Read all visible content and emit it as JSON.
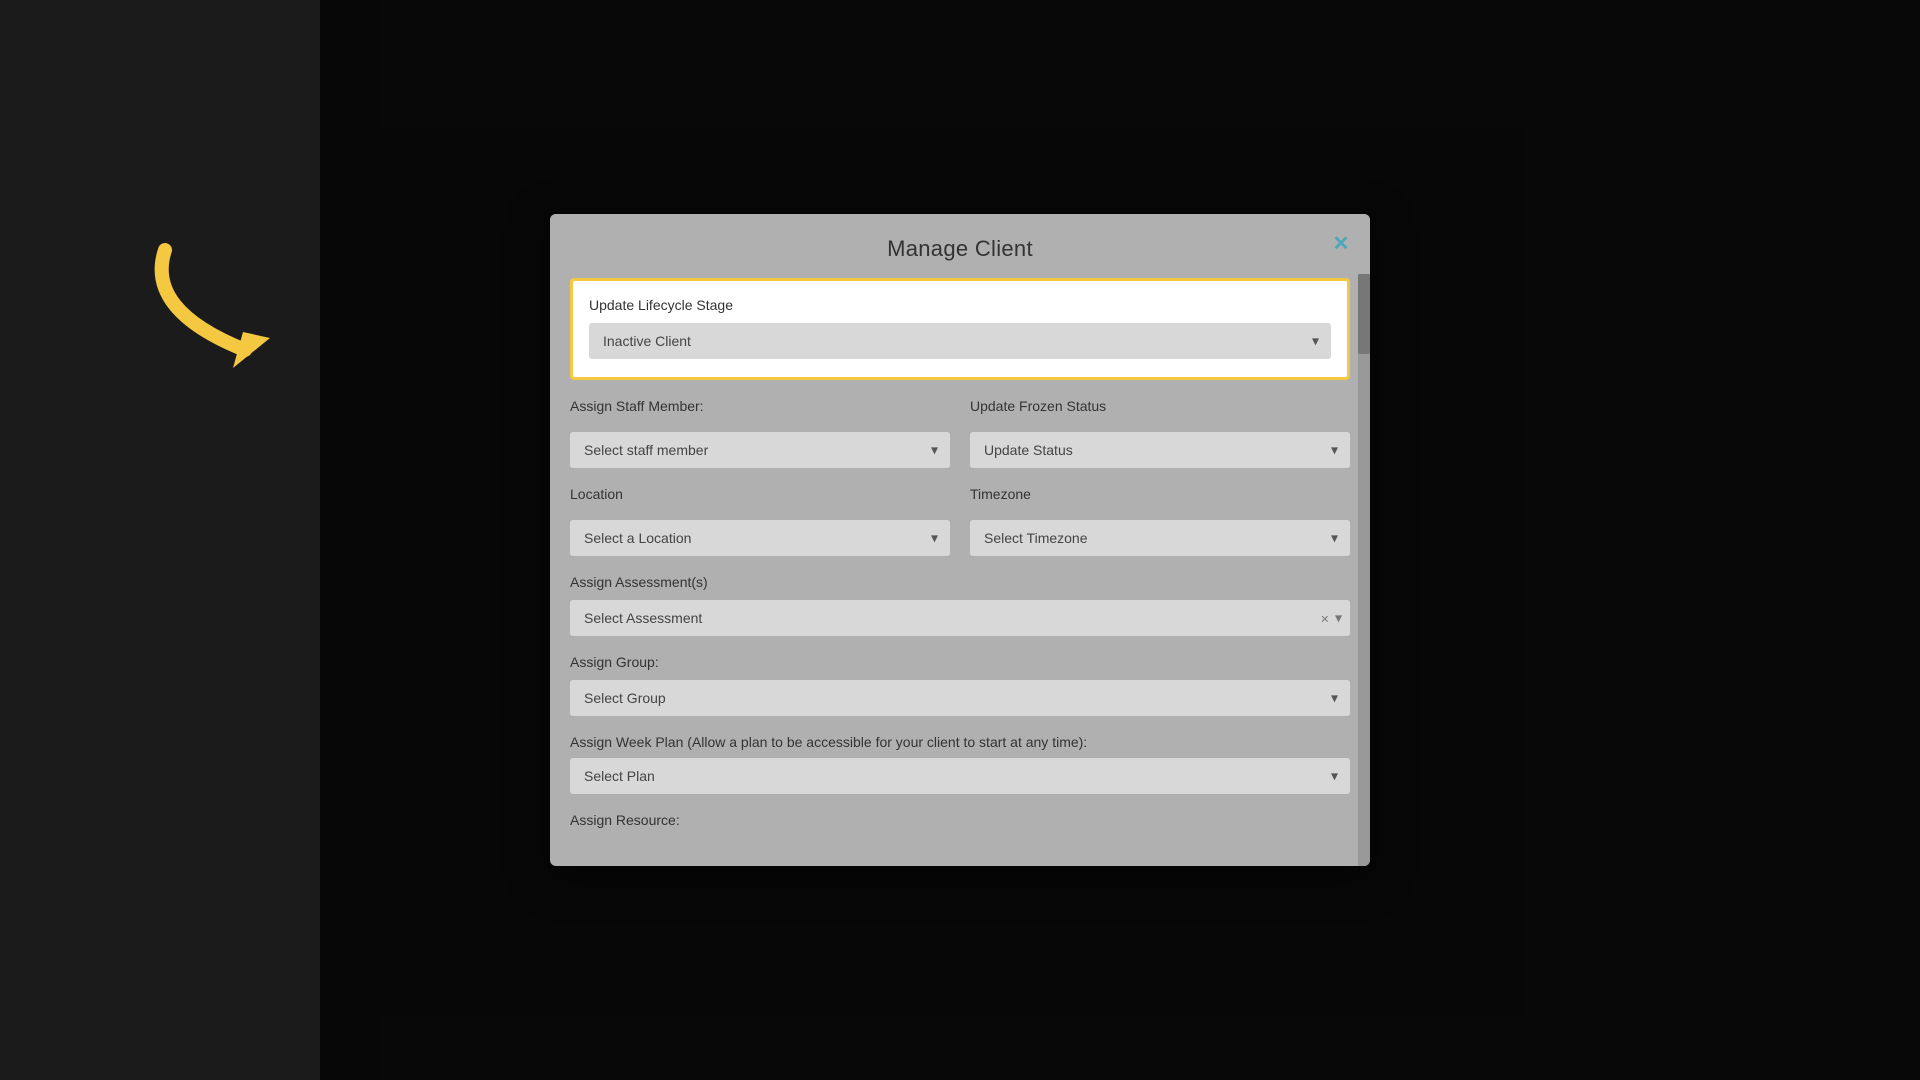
{
  "background": {
    "color": "#1a1a1a"
  },
  "modal": {
    "title": "Manage Client",
    "close_icon": "✕",
    "sections": {
      "lifecycle": {
        "label": "Update Lifecycle Stage",
        "dropdown_value": "Inactive Client",
        "dropdown_placeholder": "Inactive Client"
      },
      "staff": {
        "label": "Assign Staff Member:",
        "placeholder": "Select staff member"
      },
      "frozen": {
        "label": "Update Frozen Status",
        "placeholder": "Update Status"
      },
      "location": {
        "label": "Location",
        "placeholder": "Select a Location"
      },
      "timezone": {
        "label": "Timezone",
        "placeholder": "Select Timezone"
      },
      "assessment": {
        "label": "Assign Assessment(s)",
        "placeholder": "Select Assessment",
        "clear_icon": "×",
        "arrow_icon": "▾"
      },
      "group": {
        "label": "Assign Group:",
        "placeholder": "Select Group"
      },
      "plan": {
        "label": "Assign Week Plan (Allow a plan to be accessible for your client to start at any time):",
        "placeholder": "Select Plan"
      },
      "resource": {
        "label": "Assign Resource:"
      }
    }
  },
  "arrow": {
    "color": "#f5c842"
  }
}
